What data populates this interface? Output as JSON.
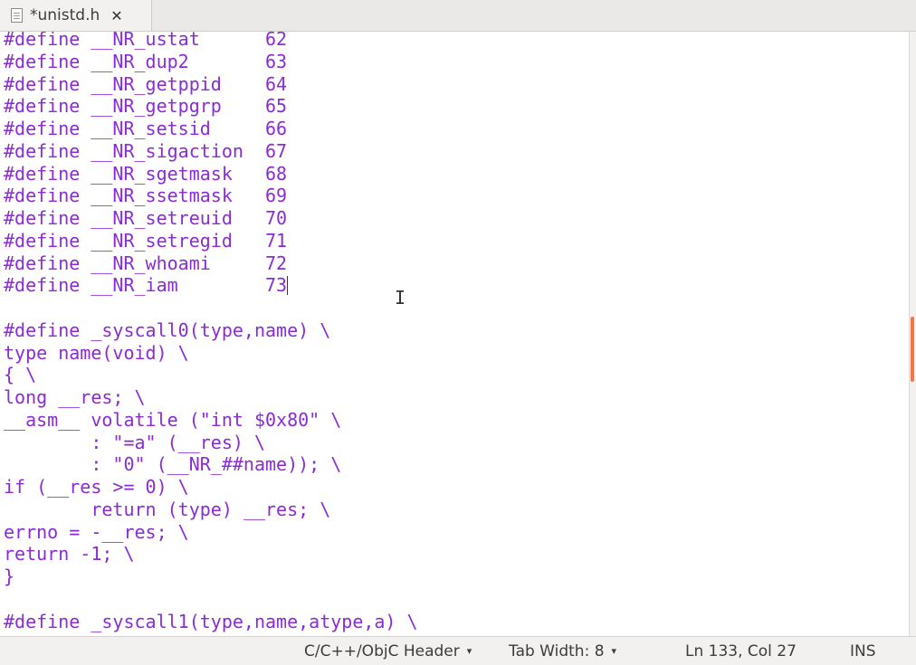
{
  "tab": {
    "title": "*unistd.h",
    "close_label": "✕",
    "icon": "text-file-icon"
  },
  "editor": {
    "text_color": "#8b2bd6",
    "lines": [
      "#define __NR_ustat      62",
      "#define __NR_dup2       63",
      "#define __NR_getppid    64",
      "#define __NR_getpgrp    65",
      "#define __NR_setsid     66",
      "#define __NR_sigaction  67",
      "#define __NR_sgetmask   68",
      "#define __NR_ssetmask   69",
      "#define __NR_setreuid   70",
      "#define __NR_setregid   71",
      "#define __NR_whoami     72",
      "#define __NR_iam        73",
      "",
      "#define _syscall0(type,name) \\",
      "type name(void) \\",
      "{ \\",
      "long __res; \\",
      "__asm__ volatile (\"int $0x80\" \\",
      "        : \"=a\" (__res) \\",
      "        : \"0\" (__NR_##name)); \\",
      "if (__res >= 0) \\",
      "        return (type) __res; \\",
      "errno = -__res; \\",
      "return -1; \\",
      "}",
      "",
      "#define _syscall1(type,name,atype,a) \\"
    ],
    "cursor_line_index": 11
  },
  "scrollbar": {
    "thumb_color": "#f07746"
  },
  "status": {
    "language": "C/C++/ObjC Header",
    "tab_width": "Tab Width: 8",
    "position": "Ln 133, Col 27",
    "mode": "INS",
    "dropdown_arrow": "▾"
  }
}
